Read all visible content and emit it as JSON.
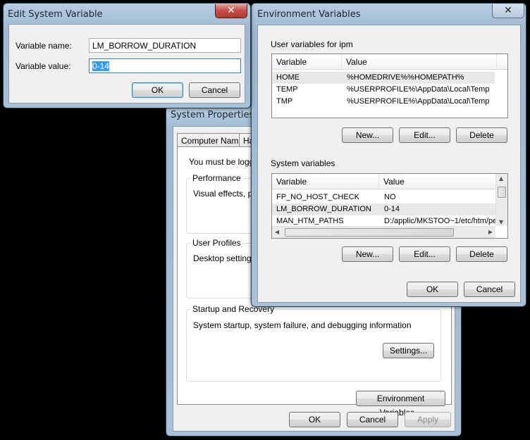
{
  "system_properties": {
    "title": "System Properties",
    "tabs": [
      "Computer Name",
      "Ha"
    ],
    "admin_note": "You must be logged",
    "performance": {
      "title": "Performance",
      "desc": "Visual effects, pro"
    },
    "user_profiles": {
      "title": "User Profiles",
      "desc": "Desktop settings r"
    },
    "startup": {
      "title": "Startup and Recovery",
      "desc": "System startup, system failure, and debugging information",
      "settings_label": "Settings..."
    },
    "env_vars_label": "Environment Variables...",
    "ok_label": "OK",
    "cancel_label": "Cancel",
    "apply_label": "Apply"
  },
  "environment_variables": {
    "title": "Environment Variables",
    "close_glyph": "✕",
    "user_section_title": "User variables for ipm",
    "columns": {
      "variable": "Variable",
      "value": "Value"
    },
    "user_rows": [
      {
        "variable": "HOME",
        "value": "%HOMEDRIVE%%HOMEPATH%"
      },
      {
        "variable": "TEMP",
        "value": "%USERPROFILE%\\AppData\\Local\\Temp"
      },
      {
        "variable": "TMP",
        "value": "%USERPROFILE%\\AppData\\Local\\Temp"
      }
    ],
    "system_section_title": "System variables",
    "system_rows": [
      {
        "variable": "FP_NO_HOST_CHECK",
        "value": "NO"
      },
      {
        "variable": "LM_BORROW_DURATION",
        "value": "0-14"
      },
      {
        "variable": "MAN_HTM_PATHS",
        "value": "D:/applic/MKSTOO~1/etc/htm/pe"
      }
    ],
    "new_label": "New...",
    "edit_label": "Edit...",
    "delete_label": "Delete",
    "ok_label": "OK",
    "cancel_label": "Cancel"
  },
  "edit_dialog": {
    "title": "Edit System Variable",
    "close_glyph": "✕",
    "name_label": "Variable name:",
    "name_value": "LM_BORROW_DURATION",
    "value_label": "Variable value:",
    "value_value": "0-14",
    "ok_label": "OK",
    "cancel_label": "Cancel"
  },
  "colors": {
    "selection": "#3399ff",
    "close_button": "#c75050",
    "frame": "#a9c0d6"
  }
}
